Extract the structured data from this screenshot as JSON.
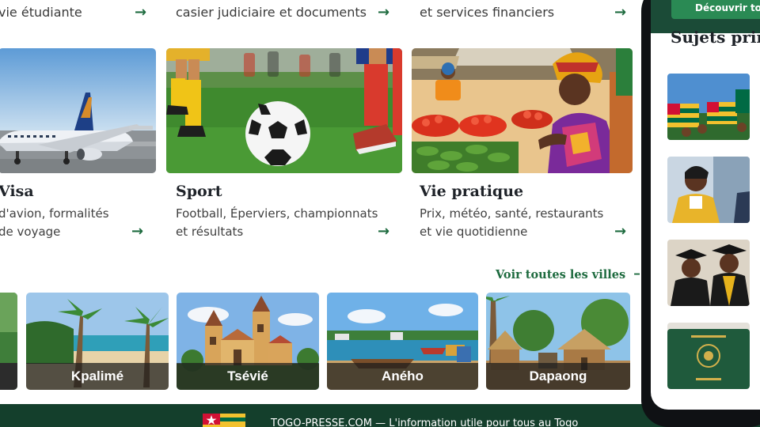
{
  "top_row": [
    {
      "text": "vie étudiante"
    },
    {
      "text": "casier judiciaire et documents"
    },
    {
      "text": "et services financiers"
    }
  ],
  "cards": [
    {
      "title": "Visa",
      "desc_lines": [
        "d'avion, formalités",
        "de voyage"
      ]
    },
    {
      "title": "Sport",
      "desc_lines": [
        "Football, Éperviers, championnats",
        "et résultats"
      ]
    },
    {
      "title": "Vie pratique",
      "desc_lines": [
        "Prix, météo, santé, restaurants",
        "et vie quotidienne"
      ]
    }
  ],
  "see_all_cities": "Voir toutes les villes",
  "cities": [
    {
      "name": "Kpalimé"
    },
    {
      "name": "Tsévié"
    },
    {
      "name": "Aného"
    },
    {
      "name": "Dapaong"
    }
  ],
  "footer": {
    "text": "TOGO-PRESSE.COM — L'information utile pour tous au Togo"
  },
  "phone": {
    "button_label": "Découvrir to",
    "section_heading": "Sujets princ"
  },
  "colors": {
    "accent": "#1e6b3f",
    "footer_bg": "#143f2c",
    "button": "#2a8a54"
  },
  "icons": {
    "arrow": "arrow-right-icon"
  }
}
